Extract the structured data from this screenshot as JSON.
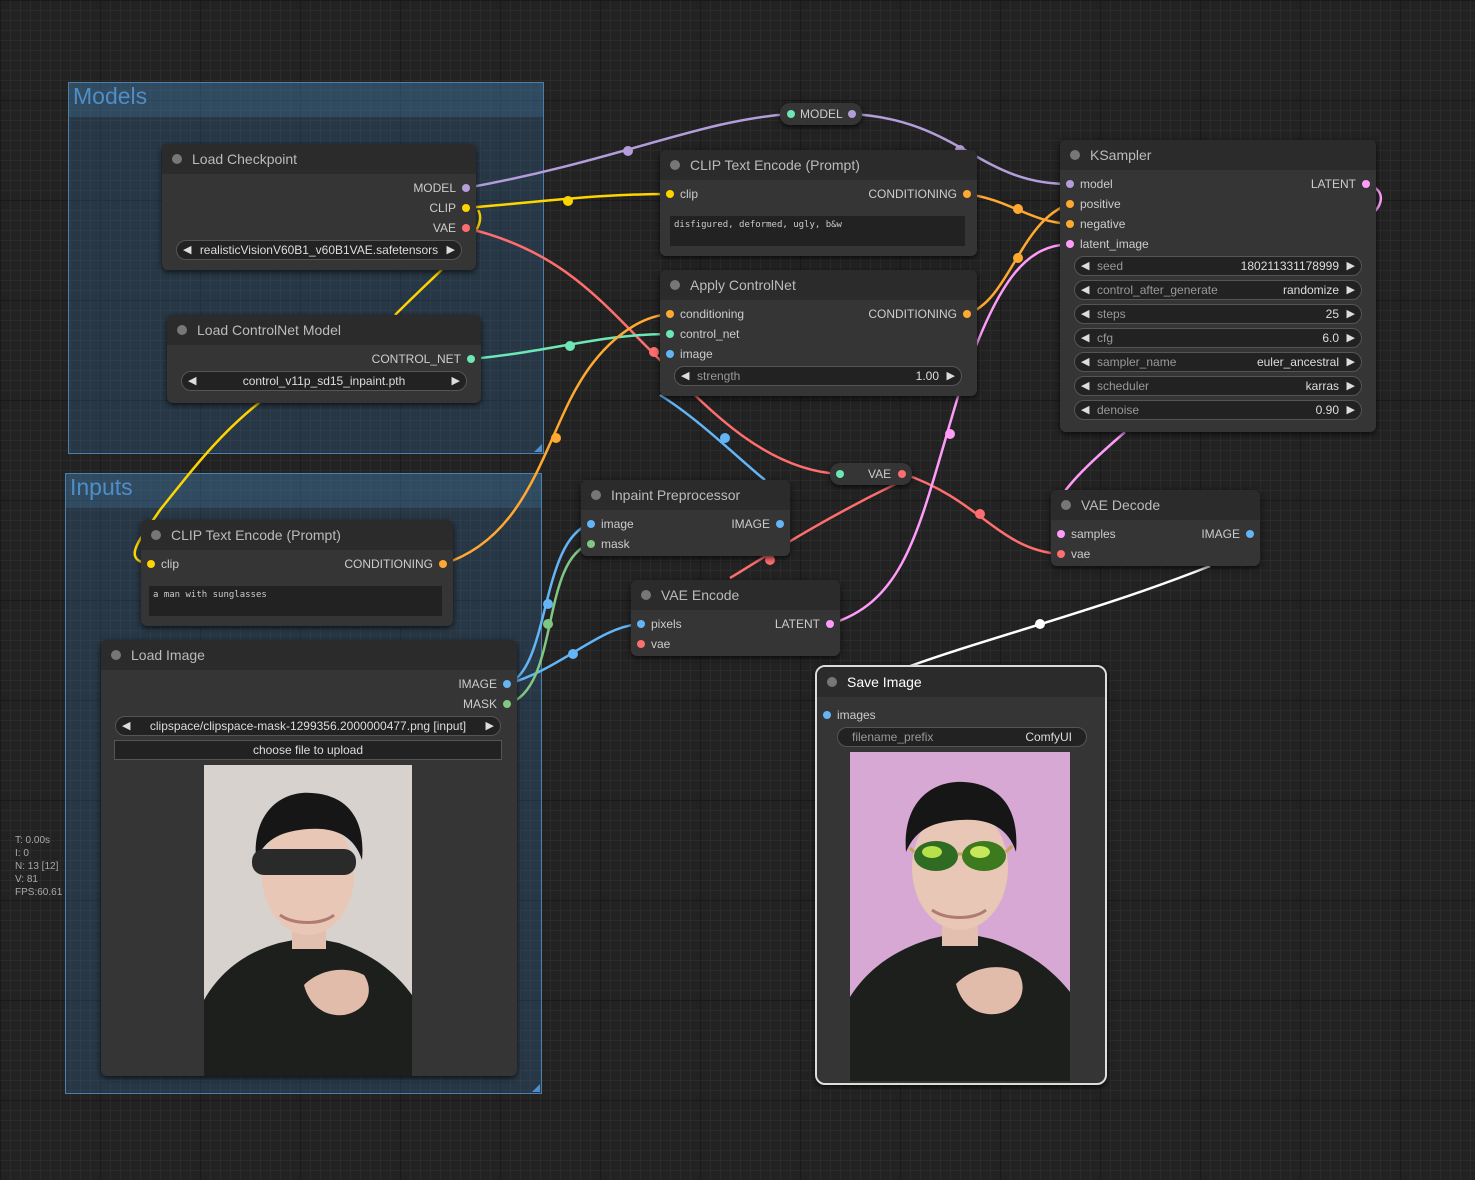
{
  "colors": {
    "MODEL": "#b39ddb",
    "CLIP": "#ffd500",
    "VAE": "#ff6e6e",
    "CONDITIONING": "#ffa931",
    "CONTROL_NET": "#6ee7b7",
    "IMAGE": "#64b5f6",
    "MASK": "#81c784",
    "LATENT": "#ff9cf9"
  },
  "groups": {
    "models": "Models",
    "inputs": "Inputs"
  },
  "load_checkpoint": {
    "title": "Load Checkpoint",
    "outputs": [
      "MODEL",
      "CLIP",
      "VAE"
    ],
    "ckpt_name": "realisticVisionV60B1_v60B1VAE.safetensors"
  },
  "load_controlnet": {
    "title": "Load ControlNet Model",
    "output": "CONTROL_NET",
    "control_net_name": "control_v11p_sd15_inpaint.pth"
  },
  "clip_text_neg": {
    "title": "CLIP Text Encode (Prompt)",
    "input": "clip",
    "output": "CONDITIONING",
    "text": "disfigured, deformed, ugly, b&w"
  },
  "apply_controlnet": {
    "title": "Apply ControlNet",
    "inputs": [
      "conditioning",
      "control_net",
      "image"
    ],
    "output": "CONDITIONING",
    "strength_label": "strength",
    "strength": "1.00"
  },
  "ksampler": {
    "title": "KSampler",
    "inputs": [
      "model",
      "positive",
      "negative",
      "latent_image"
    ],
    "output": "LATENT",
    "widgets": [
      {
        "name": "seed",
        "value": "180211331178999"
      },
      {
        "name": "control_after_generate",
        "value": "randomize"
      },
      {
        "name": "steps",
        "value": "25"
      },
      {
        "name": "cfg",
        "value": "6.0"
      },
      {
        "name": "sampler_name",
        "value": "euler_ancestral"
      },
      {
        "name": "scheduler",
        "value": "karras"
      },
      {
        "name": "denoise",
        "value": "0.90"
      }
    ]
  },
  "reroute_model": "MODEL",
  "reroute_vae": "VAE",
  "clip_text_pos": {
    "title": "CLIP Text Encode (Prompt)",
    "input": "clip",
    "output": "CONDITIONING",
    "text": "a man with sunglasses"
  },
  "inpaint_pre": {
    "title": "Inpaint Preprocessor",
    "inputs": [
      "image",
      "mask"
    ],
    "output": "IMAGE"
  },
  "vae_encode": {
    "title": "VAE Encode",
    "inputs": [
      "pixels",
      "vae"
    ],
    "output": "LATENT"
  },
  "vae_decode": {
    "title": "VAE Decode",
    "inputs": [
      "samples",
      "vae"
    ],
    "output": "IMAGE"
  },
  "load_image": {
    "title": "Load Image",
    "outputs": [
      "IMAGE",
      "MASK"
    ],
    "image": "clipspace/clipspace-mask-1299356.2000000477.png [input]",
    "upload_label": "choose file to upload"
  },
  "save_image": {
    "title": "Save Image",
    "input": "images",
    "prefix_label": "filename_prefix",
    "prefix": "ComfyUI"
  },
  "stats": [
    "T: 0.00s",
    "I: 0",
    "N: 13 [12]",
    "V: 81",
    "FPS:60.61"
  ]
}
